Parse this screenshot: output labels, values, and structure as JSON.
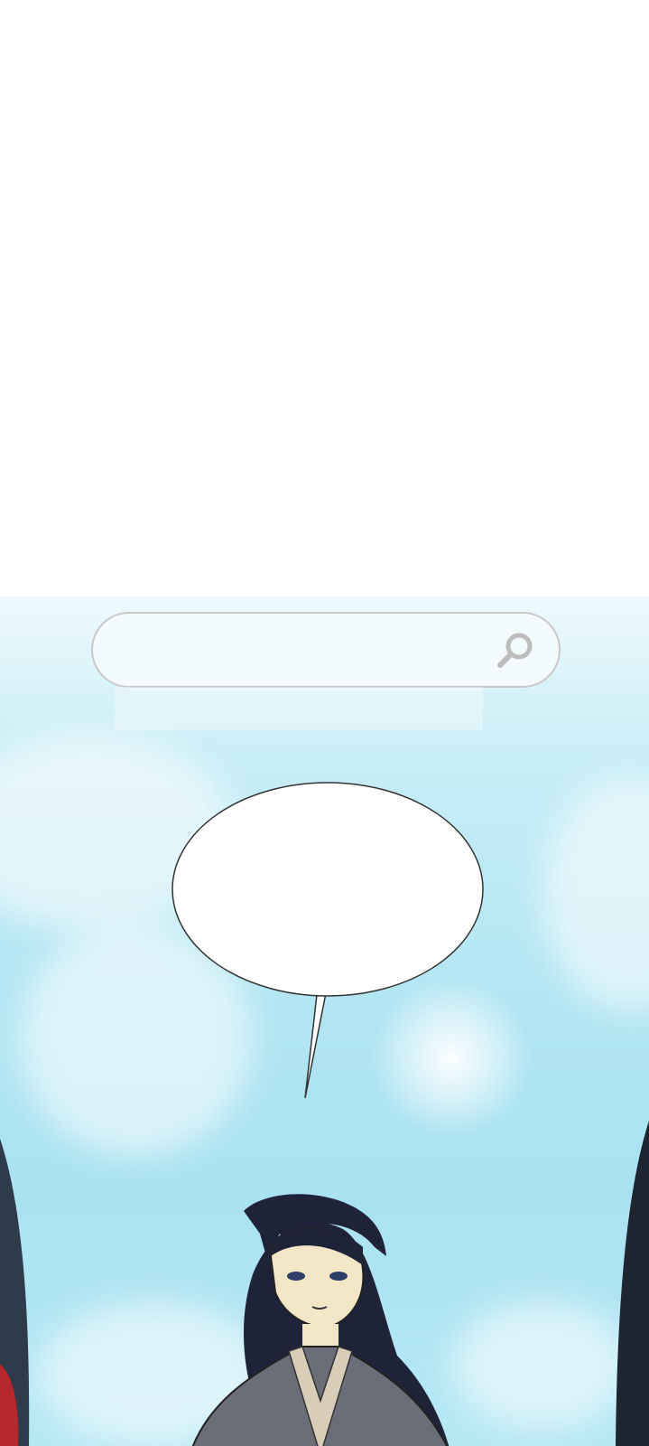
{
  "search": {
    "value": "",
    "placeholder": "",
    "icon": "magnifier-icon"
  },
  "speech_bubble": {
    "text": ""
  },
  "colors": {
    "sky_top": "#eefafd",
    "sky_mid": "#b4e6f3",
    "hair": "#1f2338",
    "robe": "#6b6e79",
    "collar": "#d8cdb8"
  }
}
